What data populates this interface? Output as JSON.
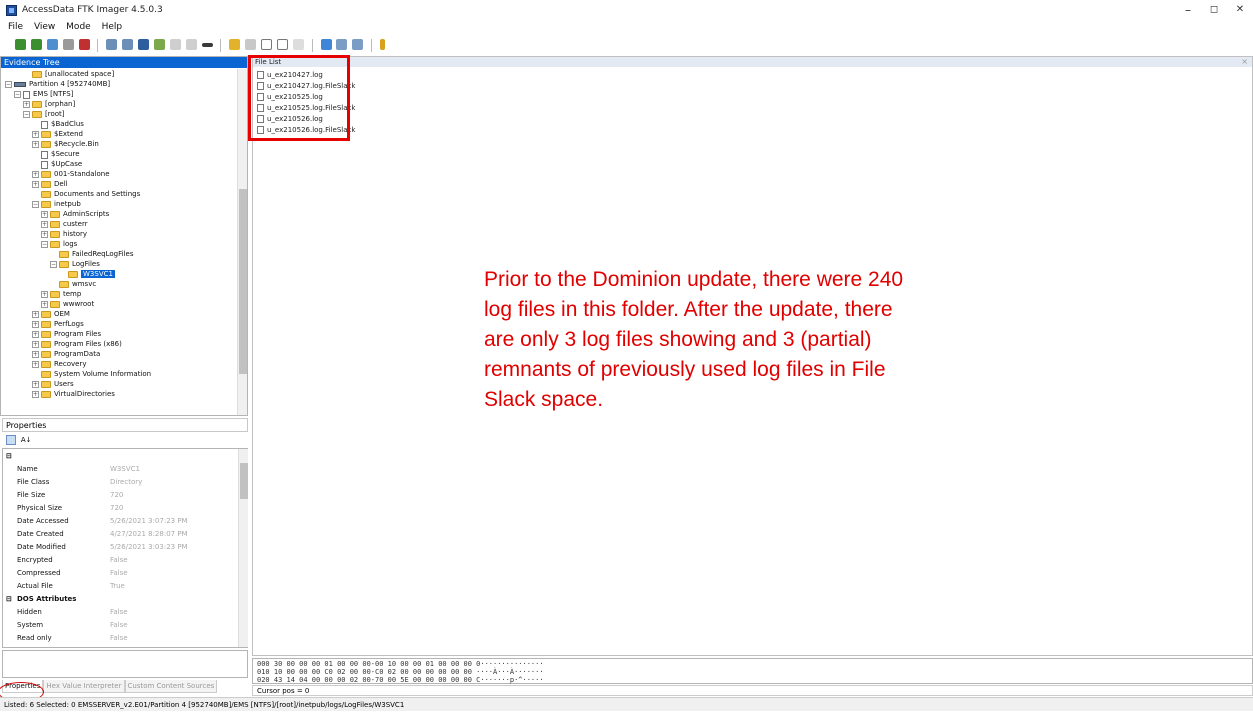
{
  "window": {
    "title": "AccessData FTK Imager 4.5.0.3",
    "minimize": "–",
    "maximize": "◻",
    "close": "✕"
  },
  "menu": [
    "File",
    "View",
    "Mode",
    "Help"
  ],
  "evidence_tree": {
    "header": "Evidence Tree",
    "items": [
      {
        "label": "[unallocated space]",
        "type": "folder",
        "indent": 4,
        "exp": ""
      },
      {
        "label": "Partition 4 [952740MB]",
        "type": "partition",
        "indent": 2,
        "exp": "−"
      },
      {
        "label": "EMS [NTFS]",
        "type": "fs",
        "indent": 3,
        "exp": "−"
      },
      {
        "label": "[orphan]",
        "type": "folder",
        "indent": 4,
        "exp": "+"
      },
      {
        "label": "[root]",
        "type": "folder",
        "indent": 4,
        "exp": "−"
      },
      {
        "label": "$BadClus",
        "type": "file",
        "indent": 5,
        "exp": ""
      },
      {
        "label": "$Extend",
        "type": "folder",
        "indent": 5,
        "exp": "+"
      },
      {
        "label": "$Recycle.Bin",
        "type": "folder",
        "indent": 5,
        "exp": "+"
      },
      {
        "label": "$Secure",
        "type": "file",
        "indent": 5,
        "exp": ""
      },
      {
        "label": "$UpCase",
        "type": "file",
        "indent": 5,
        "exp": ""
      },
      {
        "label": "001-Standalone",
        "type": "folder",
        "indent": 5,
        "exp": "+"
      },
      {
        "label": "Dell",
        "type": "folder",
        "indent": 5,
        "exp": "+"
      },
      {
        "label": "Documents and Settings",
        "type": "folder",
        "indent": 5,
        "exp": ""
      },
      {
        "label": "inetpub",
        "type": "folder",
        "indent": 5,
        "exp": "−"
      },
      {
        "label": "AdminScripts",
        "type": "folder",
        "indent": 6,
        "exp": "+"
      },
      {
        "label": "custerr",
        "type": "folder",
        "indent": 6,
        "exp": "+"
      },
      {
        "label": "history",
        "type": "folder",
        "indent": 6,
        "exp": "+"
      },
      {
        "label": "logs",
        "type": "folder",
        "indent": 6,
        "exp": "−"
      },
      {
        "label": "FailedReqLogFiles",
        "type": "folder",
        "indent": 7,
        "exp": ""
      },
      {
        "label": "LogFiles",
        "type": "folder",
        "indent": 7,
        "exp": "−"
      },
      {
        "label": "W3SVC1",
        "type": "folder",
        "indent": 8,
        "exp": "",
        "selected": true
      },
      {
        "label": "wmsvc",
        "type": "folder",
        "indent": 7,
        "exp": ""
      },
      {
        "label": "temp",
        "type": "folder",
        "indent": 6,
        "exp": "+"
      },
      {
        "label": "wwwroot",
        "type": "folder",
        "indent": 6,
        "exp": "+"
      },
      {
        "label": "OEM",
        "type": "folder",
        "indent": 5,
        "exp": "+"
      },
      {
        "label": "PerfLogs",
        "type": "folder",
        "indent": 5,
        "exp": "+"
      },
      {
        "label": "Program Files",
        "type": "folder",
        "indent": 5,
        "exp": "+"
      },
      {
        "label": "Program Files (x86)",
        "type": "folder",
        "indent": 5,
        "exp": "+"
      },
      {
        "label": "ProgramData",
        "type": "folder",
        "indent": 5,
        "exp": "+"
      },
      {
        "label": "Recovery",
        "type": "folder",
        "indent": 5,
        "exp": "+"
      },
      {
        "label": "System Volume Information",
        "type": "folder",
        "indent": 5,
        "exp": ""
      },
      {
        "label": "Users",
        "type": "folder",
        "indent": 5,
        "exp": "+"
      },
      {
        "label": "VirtualDirectories",
        "type": "folder",
        "indent": 5,
        "exp": "+"
      }
    ]
  },
  "properties": {
    "caption": "Properties",
    "sort_icon": "A↓",
    "rows": [
      {
        "name": "",
        "value": "",
        "group": true,
        "toggle": "⊟"
      },
      {
        "name": "Name",
        "value": "W3SVC1"
      },
      {
        "name": "File Class",
        "value": "Directory"
      },
      {
        "name": "File Size",
        "value": "720"
      },
      {
        "name": "Physical Size",
        "value": "720"
      },
      {
        "name": "Date Accessed",
        "value": "5/26/2021 3:07:23 PM"
      },
      {
        "name": "Date Created",
        "value": "4/27/2021 8:28:07 PM"
      },
      {
        "name": "Date Modified",
        "value": "5/26/2021 3:03:23 PM"
      },
      {
        "name": "Encrypted",
        "value": "False"
      },
      {
        "name": "Compressed",
        "value": "False"
      },
      {
        "name": "Actual File",
        "value": "True"
      },
      {
        "name": "DOS Attributes",
        "value": "",
        "group": true,
        "toggle": "⊟"
      },
      {
        "name": "Hidden",
        "value": "False"
      },
      {
        "name": "System",
        "value": "False"
      },
      {
        "name": "Read only",
        "value": "False"
      }
    ]
  },
  "bottom_tabs": [
    "Properties",
    "Hex Value Interpreter",
    "Custom Content Sources"
  ],
  "file_list": {
    "header": "File List",
    "close": "×",
    "files": [
      "u_ex210427.log",
      "u_ex210427.log.FileSlack",
      "u_ex210525.log",
      "u_ex210525.log.FileSlack",
      "u_ex210526.log",
      "u_ex210526.log.FileSlack"
    ]
  },
  "annotation": "Prior to the Dominion update, there were 240 log files in this folder. After the update, there are only 3 log files showing and 3 (partial) remnants of previously used log files in File Slack space.",
  "hex": {
    "lines": [
      "000 30 00 00 00 01 00 00 00-00 10 00 00 01 00 00 00 0···············",
      "010 10 00 00 00 C0 02 00 00-C0 02 00 00 00 00 00 00 ····À···À·······",
      "020 43 14 04 00 00 00 02 00-70 00 5E 00 00 00 00 00 C·······p·^·····"
    ],
    "cursor": "Cursor pos = 0"
  },
  "status": "Listed: 6  Selected: 0  EMSSERVER_v2.E01/Partition 4 [952740MB]/EMS [NTFS]/[root]/inetpub/logs/LogFiles/W3SVC1",
  "colors": {
    "selection": "#0a64d2",
    "annotation": "#e00000"
  }
}
